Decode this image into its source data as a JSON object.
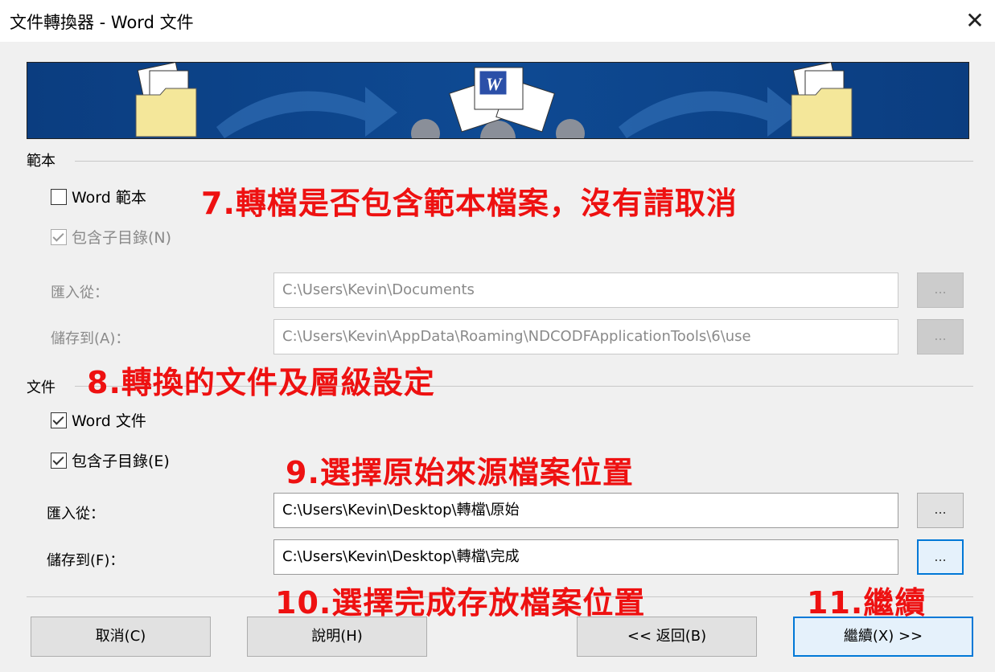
{
  "window": {
    "title": "文件轉換器 - Word 文件",
    "close_glyph": "✕"
  },
  "template_group": {
    "label": "範本",
    "word_template": {
      "label": "Word 範本",
      "checked": false
    },
    "include_subdirs": {
      "label": "包含子目錄(N)",
      "checked": true,
      "disabled": true
    },
    "import_from": {
      "label": "匯入從：",
      "value": "C:\\Users\\Kevin\\Documents"
    },
    "save_to": {
      "label": "儲存到(A)：",
      "value": "C:\\Users\\Kevin\\AppData\\Roaming\\NDCODFApplicationTools\\6\\use"
    },
    "browse_label": "..."
  },
  "document_group": {
    "label": "文件",
    "word_doc": {
      "label": "Word 文件",
      "checked": true
    },
    "include_subdirs": {
      "label": "包含子目錄(E)",
      "checked": true
    },
    "import_from": {
      "label": "匯入從：",
      "value": "C:\\Users\\Kevin\\Desktop\\轉檔\\原始"
    },
    "save_to": {
      "label": "儲存到(F)：",
      "value": "C:\\Users\\Kevin\\Desktop\\轉檔\\完成"
    },
    "browse_label": "..."
  },
  "buttons": {
    "cancel": "取消(C)",
    "help": "說明(H)",
    "back": "<< 返回(B)",
    "next": "繼續(X) >>"
  },
  "annotations": {
    "a7": "7.轉檔是否包含範本檔案，沒有請取消",
    "a8": "8.轉換的文件及層級設定",
    "a9": "9.選擇原始來源檔案位置",
    "a10": "10.選擇完成存放檔案位置",
    "a11": "11.繼續"
  },
  "colors": {
    "accent": "#0078d7",
    "annotation": "#ee1111",
    "banner": "#0a3a7a"
  },
  "icons": [
    "folder-icon",
    "arrow-icon",
    "word-document-icon",
    "gear-icon",
    "close-icon"
  ]
}
